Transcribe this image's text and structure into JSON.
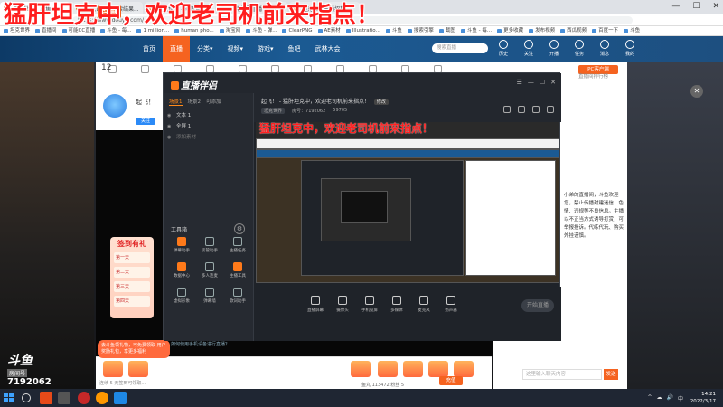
{
  "overlay": {
    "title": "猛肝坦克中，欢迎老司机前来指点！"
  },
  "browser": {
    "tabs": [
      "坦克世界-- 斗鱼...",
      "坦克世界 - 搜索结果...",
      "坦克世界 - 斗鱼直播",
      "坦克世界直播 - 斗鱼",
      "坦克世界主播招募"
    ],
    "url": "https://www.douyu.com/",
    "win_controls": [
      "—",
      "☐",
      "✕"
    ],
    "bookmarks": [
      "坦克世界",
      "直播间",
      "可能CC直播",
      "斗鱼 - 每...",
      "1 million...",
      "human pho...",
      "淘宝网",
      "斗鱼 - 弹...",
      "ClearPNG",
      "AE素材",
      "Illustratio...",
      "斗鱼",
      "搜索引擎",
      "截图",
      "斗鱼 - 每...",
      "更多收藏",
      "发布视频",
      "西瓜视频",
      "百度一下",
      "斗鱼"
    ]
  },
  "site": {
    "logo": "斗鱼",
    "nav": [
      "首页",
      "直播",
      "分类▾",
      "视频▾",
      "游戏▾",
      "鱼吧",
      "武林大会"
    ],
    "search_placeholder": "搜索直播",
    "header_icons": [
      "历史",
      "关注",
      "开播",
      "任务",
      "消息",
      "我的"
    ]
  },
  "room": {
    "fan_count": "12",
    "streamer_name": "起飞！",
    "follow_label": "关注",
    "rank_button": "PC客户端",
    "rank_panel_title": "直播间排行榜",
    "sign_in_title": "签到有礼",
    "sign_in_rows": [
      "第一天",
      "第二天",
      "第三天",
      "第四天"
    ],
    "promo_toast": "去斗鱼领礼物，可免费领取\n用户奖励礼包，享更多福利",
    "gift_bar_text": "连续 5 天签到可领取...",
    "stats": "鱼丸 113472 粉丝 5",
    "charge_label": "充值",
    "announcement": "小弟的直播间，斗鱼欢迎您，禁止传播封建迷信、色情、违规等不良信息。主播以不正当方式诱导打赏，可举报投诉。代练代玩、购买外挂谨慎。",
    "chat_placeholder": "这里输入聊天内容",
    "send_label": "发送"
  },
  "app": {
    "logo": "直播伴侣",
    "title_right": [
      "☰",
      "—",
      "☐",
      "✕"
    ],
    "scene_tabs": [
      "场景1",
      "场景2",
      "可添加"
    ],
    "sources": [
      {
        "label": "文本 1",
        "dim": false
      },
      {
        "label": "全屏 1",
        "dim": false
      },
      {
        "label": "添加素材",
        "dim": true
      }
    ],
    "tools_title": "工具箱",
    "tools": [
      {
        "label": "弹幕助手",
        "hot": true
      },
      {
        "label": "房管助手",
        "hot": false
      },
      {
        "label": "主播任务",
        "hot": false
      },
      {
        "label": "数据中心",
        "hot": true
      },
      {
        "label": "多人连麦",
        "hot": false
      },
      {
        "label": "主播工具",
        "hot": true
      },
      {
        "label": "虚拟形象",
        "hot": false
      },
      {
        "label": "弹幕墙",
        "hot": false
      },
      {
        "label": "歌词助手",
        "hot": false
      }
    ],
    "bottom_link": "如何使用手机设备进行直播？",
    "room_title": "起飞！ - 猛肝坦克中，欢迎老司机前来指点！",
    "room_title_tag": "修改",
    "meta": {
      "category": "坦克世界",
      "room_id": "房号：7192062",
      "fans": "59705"
    },
    "preview_title": "猛肝坦克中，欢迎老司机前来指点！",
    "controls": [
      "直播屏幕",
      "摄像头",
      "手机投屏",
      "多媒体",
      "麦克风",
      "扬声器"
    ],
    "start_label": "开始直播"
  },
  "branding": {
    "logo": "斗鱼",
    "sub": "房间号",
    "room_id": "7192062"
  },
  "taskbar": {
    "time": "14:21",
    "date": "2022/3/17",
    "tray": [
      "^",
      "☁",
      "🔊",
      "中"
    ]
  }
}
